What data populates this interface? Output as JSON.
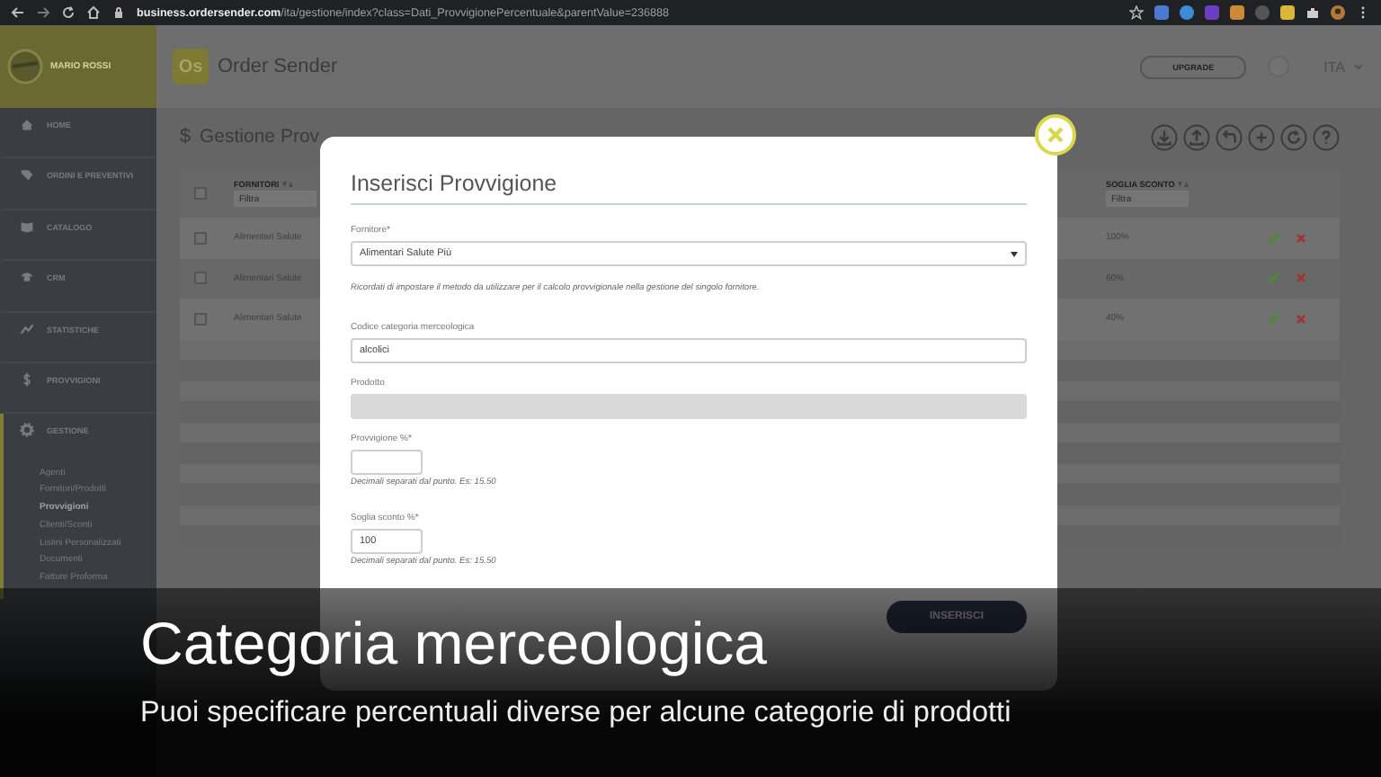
{
  "browser": {
    "url": "**business.ordersender.com**/ita/gestione/index?class=Dati_ProvvigionePercentuale&parentValue=236888"
  },
  "user": {
    "name": "MARIO ROSSI"
  },
  "header": {
    "logo_text": "Os",
    "app_name": "Order Sender",
    "upgrade_button": "UPGRADE",
    "language": "ITA"
  },
  "sidebar": {
    "items": [
      {
        "label": "HOME",
        "selected": false
      },
      {
        "label": "ORDINI E PREVENTIVI",
        "selected": false
      },
      {
        "label": "CATALOGO",
        "selected": false
      },
      {
        "label": "CRM",
        "selected": false
      },
      {
        "label": "STATISTICHE",
        "selected": false
      },
      {
        "label": "PROVVIGIONI",
        "selected": false
      },
      {
        "label": "GESTIONE",
        "selected": true,
        "children": [
          {
            "label": "Agenti",
            "selected": false
          },
          {
            "label": "Fornitori/Prodotti",
            "selected": false
          },
          {
            "label": "Provvigioni",
            "selected": true
          },
          {
            "label": "Clienti/Sconti",
            "selected": false
          },
          {
            "label": "Listini Personalizzati",
            "selected": false
          },
          {
            "label": "Documenti",
            "selected": false
          },
          {
            "label": "Fatture Proforma",
            "selected": false
          }
        ]
      }
    ]
  },
  "page": {
    "icon_char": "$",
    "title": "Gestione Prov"
  },
  "table": {
    "select_all_checked": false,
    "columns": [
      {
        "label": "FORNITORI",
        "filter_placeholder": "Filtra"
      },
      {
        "label": "SOGLIA SCONTO",
        "filter_placeholder": "Filtra"
      }
    ],
    "rows": [
      {
        "checked": false,
        "cells": [
          "Alimentari Salute",
          "100%"
        ]
      },
      {
        "checked": false,
        "cells": [
          "Alimentari Salute",
          "60%"
        ]
      },
      {
        "checked": false,
        "cells": [
          "Alimentari Salute",
          "40%"
        ]
      }
    ]
  },
  "modal": {
    "title": "Inserisci Provvigione",
    "fields": [
      {
        "kind": "select",
        "label": "Fornitore*",
        "value": "Alimentari Salute Più"
      },
      {
        "kind": "note",
        "text": "Ricordati di impostare il metodo da utilizzare per il calcolo provvigionale nella gestione del singolo fornitore."
      },
      {
        "kind": "text",
        "label": "Codice categoria merceologica",
        "value": "alcolici"
      },
      {
        "kind": "readonly",
        "label": "Prodotto"
      },
      {
        "kind": "short",
        "label": "Provvigione %*"
      },
      {
        "kind": "hint",
        "text": "Decimali separati dal punto. Es: 15.50"
      },
      {
        "kind": "short",
        "label": "Soglia sconto %*",
        "value": "100"
      },
      {
        "kind": "hint",
        "text": "Decimali separati dal punto. Es: 15.50"
      }
    ],
    "submit_button": "INSERISCI"
  },
  "caption": {
    "title": "Categoria merceologica",
    "subtitle": "Puoi specificare percentuali diverse per alcune categorie di prodotti"
  }
}
